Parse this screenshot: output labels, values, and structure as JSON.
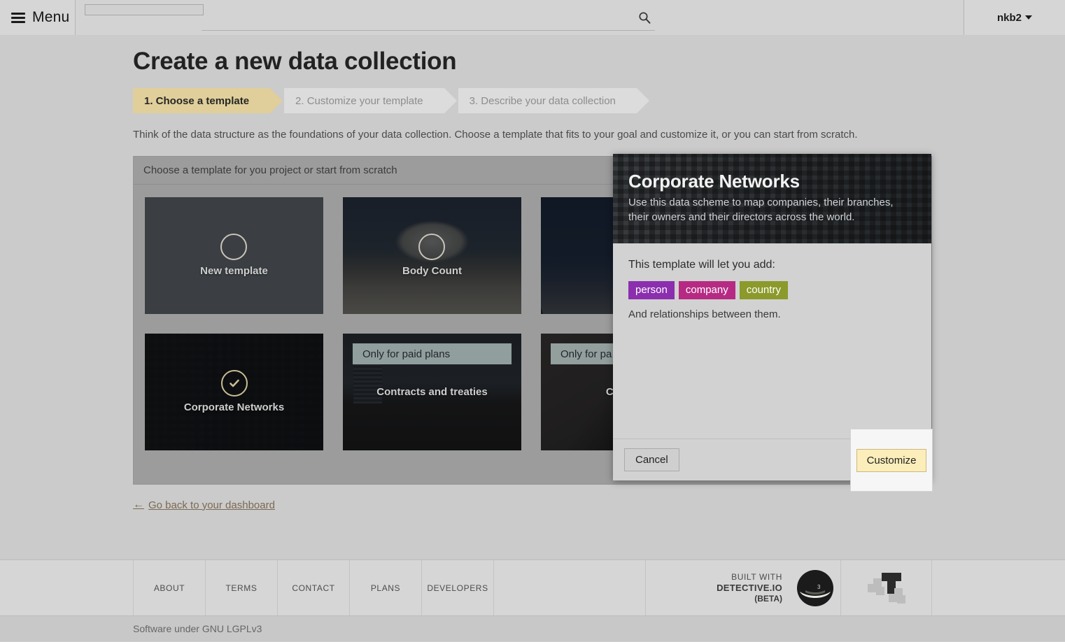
{
  "header": {
    "menu_label": "Menu",
    "menu_icon": "hamburger-icon",
    "search_placeholder": "",
    "search_value": "",
    "search_icon": "search-icon",
    "user_name": "nkb2",
    "user_caret_icon": "chevron-down-icon"
  },
  "main": {
    "page_title": "Create a new data collection",
    "steps": [
      {
        "label": "1. Choose a template",
        "active": true
      },
      {
        "label": "2. Customize your template",
        "active": false
      },
      {
        "label": "3. Describe your data collection",
        "active": false
      }
    ],
    "lead": "Think of the data structure as the foundations of your data collection. Choose a template that fits to your goal and customize it, or you can start from scratch.",
    "panel_heading": "Choose a template for you project or start from scratch",
    "templates": [
      {
        "label": "New template",
        "icon": "circle-icon",
        "selected": false,
        "paid_banner": "",
        "bg": "new-tpl"
      },
      {
        "label": "Body Count",
        "icon": "circle-icon",
        "selected": false,
        "paid_banner": "",
        "bg": "bg-bodycount"
      },
      {
        "label": "",
        "icon": "circle-icon",
        "selected": false,
        "paid_banner": "",
        "bg": "bg-night"
      },
      {
        "label": "Corporate Networks",
        "icon": "check-circle-icon",
        "selected": true,
        "paid_banner": "",
        "bg": "bg-corp"
      },
      {
        "label": "Contracts and treaties",
        "icon": "",
        "selected": false,
        "paid_banner": "Only for paid plans",
        "bg": "bg-un"
      },
      {
        "label": "Cr… pu…",
        "icon": "",
        "selected": false,
        "paid_banner": "Only for pa…",
        "bg": "bg-brown"
      }
    ],
    "back_link": "Go back to your dashboard",
    "back_icon": "arrow-left-icon"
  },
  "modal": {
    "title": "Corporate Networks",
    "subtitle": "Use this data scheme to map companies, their branches, their owners and their directors across the world.",
    "body_title": "This template will let you add:",
    "tags": [
      {
        "label": "person",
        "color": "#8b2fae"
      },
      {
        "label": "company",
        "color": "#b72a84"
      },
      {
        "label": "country",
        "color": "#8b9a2b"
      }
    ],
    "note": "And relationships between them.",
    "cancel_label": "Cancel",
    "customize_label": "Customize"
  },
  "footer": {
    "links": [
      "ABOUT",
      "TERMS",
      "CONTACT",
      "PLANS",
      "DEVELOPERS"
    ],
    "built_with_line1": "BUILT WITH",
    "built_with_line2": "DETECTIVE.IO",
    "built_with_line3": "(BETA)",
    "hat_logo_icon": "detective-hat-icon",
    "t_logo_icon": "tetris-t-logo-icon",
    "license": "Software under GNU LGPLv3"
  }
}
